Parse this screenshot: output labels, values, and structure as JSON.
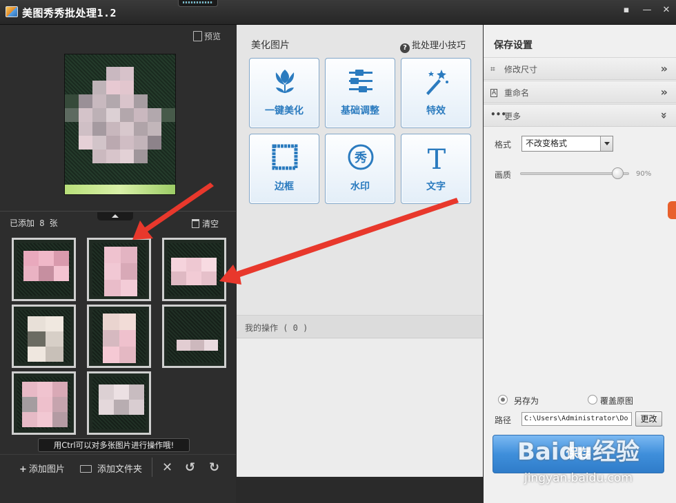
{
  "window": {
    "title": "美图秀秀批处理1.2",
    "controls": [
      "feedback-icon",
      "minimize-icon",
      "close-icon"
    ]
  },
  "left": {
    "preview_label": "预览",
    "added_count": "已添加 8 张",
    "clear_label": "清空",
    "tip": "用Ctrl可以对多张图片进行操作哦!",
    "add_image": "添加图片",
    "add_folder": "添加文件夹"
  },
  "middle": {
    "beautify_title": "美化图片",
    "tips_link": "批处理小技巧",
    "tools": [
      {
        "label": "一键美化",
        "icon": "tulip-icon"
      },
      {
        "label": "基础调整",
        "icon": "sliders-icon"
      },
      {
        "label": "特效",
        "icon": "magic-wand-icon"
      },
      {
        "label": "边框",
        "icon": "frame-icon"
      },
      {
        "label": "水印",
        "icon": "watermark-seal-icon"
      },
      {
        "label": "文字",
        "icon": "text-T-icon"
      }
    ],
    "my_ops": "我的操作 ( 0 )"
  },
  "right": {
    "title": "保存设置",
    "sections": [
      {
        "label": "修改尺寸",
        "icon": "crop-icon"
      },
      {
        "label": "重命名",
        "icon": "rename-icon"
      },
      {
        "label": "更多",
        "icon": "more-icon"
      }
    ],
    "format_label": "格式",
    "format_value": "不改变格式",
    "quality_label": "画质",
    "quality_value": "90%",
    "quality_level": 0.9,
    "save_as": "另存为",
    "overwrite": "覆盖原图",
    "path_label": "路径",
    "path_value": "C:\\Users\\Administrator\\Do",
    "change_btn": "更改",
    "save_btn": "保存"
  },
  "watermark": {
    "main": "Baidu经验",
    "sub": "jingyan.baidu.com"
  },
  "colors": {
    "accent": "#2b7bbf",
    "arrow": "#e8382c"
  }
}
